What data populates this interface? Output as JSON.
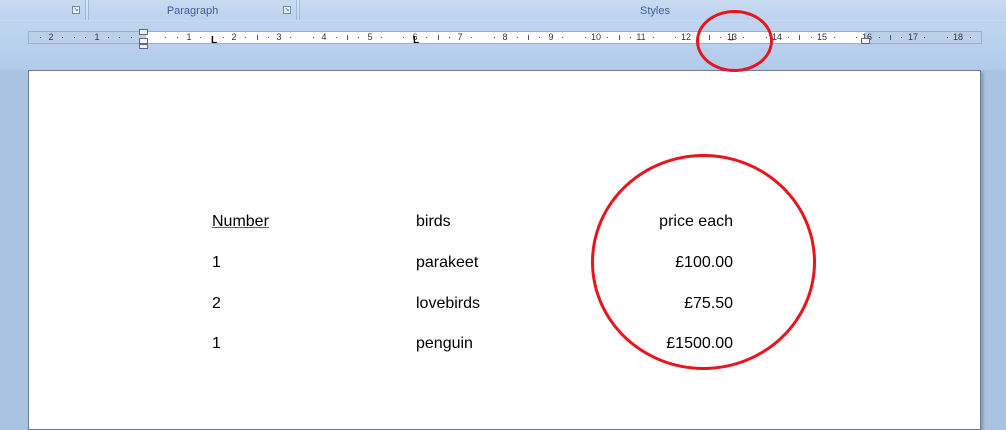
{
  "ribbon": {
    "groups": [
      {
        "label": ""
      },
      {
        "label": "Paragraph"
      },
      {
        "label": "Styles"
      }
    ]
  },
  "ruler": {
    "numbers_left": [
      "2",
      "1"
    ],
    "numbers_right": [
      "1",
      "2",
      "3",
      "4",
      "5",
      "6",
      "7",
      "8",
      "9",
      "10",
      "11",
      "12",
      "13",
      "14",
      "15",
      "16",
      "17",
      "18"
    ]
  },
  "document": {
    "headers": {
      "number": "Number",
      "birds": "birds",
      "price": "price each"
    },
    "rows": [
      {
        "number": "1",
        "bird": "parakeet",
        "price": "£100.00"
      },
      {
        "number": "2",
        "bird": "lovebirds",
        "price": "£75.50"
      },
      {
        "number": "1",
        "bird": "penguin",
        "price": "£1500.00"
      }
    ]
  },
  "annotations": {
    "circle_color": "#e8141e"
  }
}
